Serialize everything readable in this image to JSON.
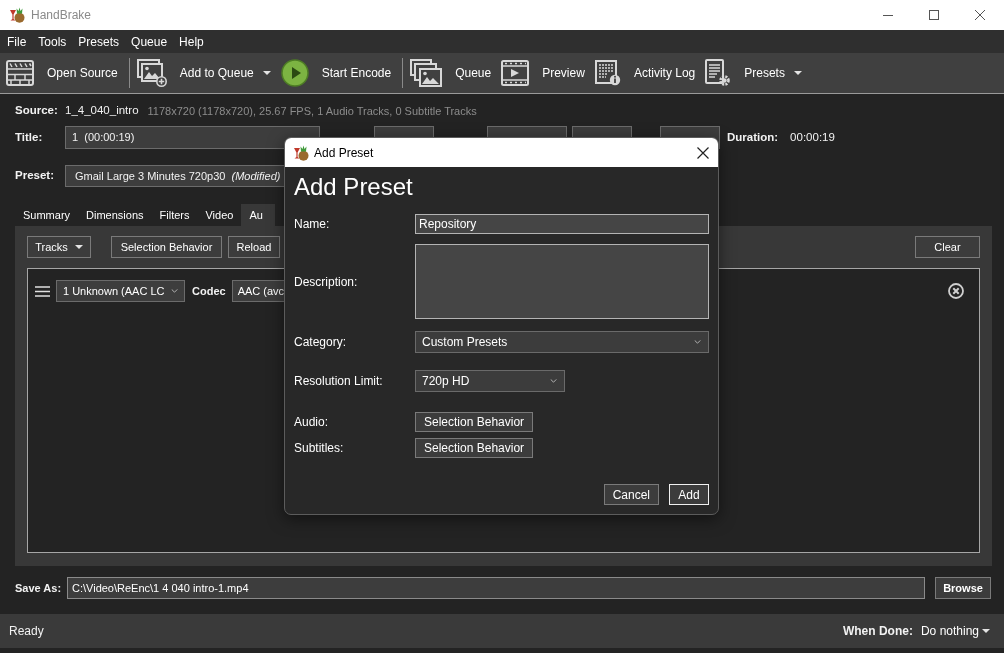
{
  "window": {
    "title": "HandBrake"
  },
  "menu": [
    "File",
    "Tools",
    "Presets",
    "Queue",
    "Help"
  ],
  "toolbar": {
    "groups": [
      [
        {
          "kind": "open_source",
          "label": "Open Source",
          "dropdown": false
        }
      ],
      [
        {
          "kind": "add_to_queue",
          "label": "Add to Queue",
          "dropdown": true
        },
        {
          "kind": "start_encode",
          "label": "Start Encode",
          "dropdown": false
        }
      ],
      [
        {
          "kind": "queue",
          "label": "Queue",
          "dropdown": false
        },
        {
          "kind": "preview",
          "label": "Preview",
          "dropdown": false
        },
        {
          "kind": "activity_log",
          "label": "Activity Log",
          "dropdown": false
        },
        {
          "kind": "presets",
          "label": "Presets",
          "dropdown": true
        }
      ]
    ]
  },
  "source": {
    "label": "Source:",
    "name": "1_4_040_intro",
    "info": "1178x720 (1178x720), 25.67 FPS, 1 Audio Tracks, 0 Subtitle Tracks"
  },
  "title": {
    "label": "Title:",
    "value": "1  (00:00:19)",
    "duration_label": "Duration:",
    "duration": "00:00:19"
  },
  "preset": {
    "label": "Preset:",
    "value": "Gmail Large 3 Minutes 720p30  *(Modified)*"
  },
  "tabs": [
    {
      "label": "Summary",
      "selected": false
    },
    {
      "label": "Dimensions",
      "selected": false
    },
    {
      "label": "Filters",
      "selected": false
    },
    {
      "label": "Video",
      "selected": false
    },
    {
      "label": "Au",
      "selected": true
    }
  ],
  "audio": {
    "buttons": [
      {
        "kind": "menu",
        "label": "Tracks"
      },
      {
        "kind": "plain",
        "label": "Selection Behavior"
      },
      {
        "kind": "plain",
        "label": "Reload"
      }
    ],
    "clear_button": "Clear",
    "tracks": [
      {
        "source": "1 Unknown (AAC LC",
        "codec_label": "Codec",
        "codec": "AAC (avc"
      }
    ]
  },
  "save_as": {
    "label": "Save As:",
    "value": "C:\\Video\\ReEnc\\1 4 040 intro-1.mp4",
    "button": "Browse"
  },
  "status_bar": {
    "status": "Ready",
    "when_done_label": "When Done:",
    "when_done": "Do nothing"
  },
  "dialog": {
    "title": "Add Preset",
    "heading": "Add Preset",
    "fields": [
      {
        "kind": "input",
        "label": "Name:",
        "value": "Repository"
      },
      {
        "kind": "textarea",
        "label": "Description:"
      },
      {
        "kind": "select",
        "label": "Category:",
        "value": "Custom Presets"
      },
      {
        "kind": "select_short",
        "label": "Resolution Limit:",
        "value": "720p HD"
      },
      {
        "kind": "button",
        "label": "Audio:",
        "value": "Selection Behavior"
      },
      {
        "kind": "button",
        "label": "Subtitles:",
        "value": "Selection Behavior"
      }
    ],
    "buttons": [
      {
        "label": "Cancel",
        "default": false
      },
      {
        "label": "Add",
        "default": true
      }
    ]
  }
}
